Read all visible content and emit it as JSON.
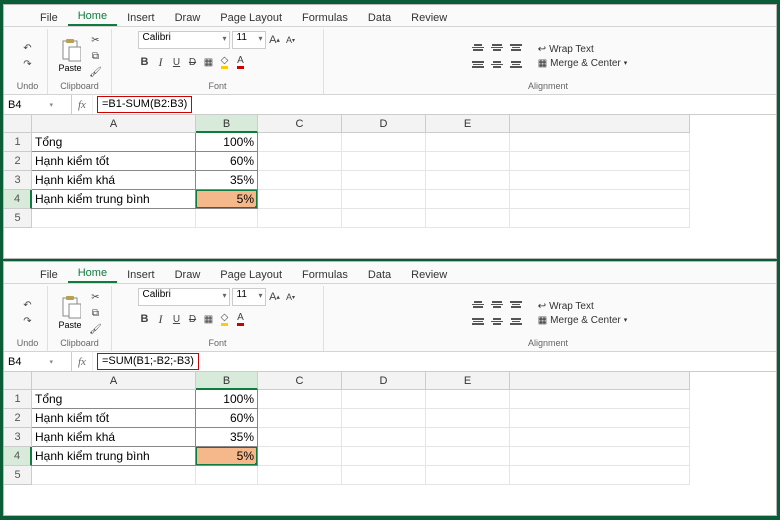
{
  "tabs": {
    "file": "File",
    "home": "Home",
    "insert": "Insert",
    "draw": "Draw",
    "pageLayout": "Page Layout",
    "formulas": "Formulas",
    "data": "Data",
    "review": "Review"
  },
  "ribbon": {
    "undo": "Undo",
    "clipboard": "Clipboard",
    "paste": "Paste",
    "font": "Font",
    "alignment": "Alignment",
    "fontName": "Calibri",
    "fontSize": "11",
    "wrapText": "Wrap Text",
    "mergeCenter": "Merge & Center",
    "B": "B",
    "I": "I",
    "U": "U",
    "D": "D"
  },
  "formulaBar": {
    "nameBox": "B4",
    "fx": "fx"
  },
  "top": {
    "formula": "=B1-SUM(B2:B3)"
  },
  "bottom": {
    "formula": "=SUM(B1;-B2;-B3)"
  },
  "chart_data": {
    "type": "table",
    "columns": [
      "A",
      "B"
    ],
    "rows": [
      {
        "A": "Tổng",
        "B": "100%"
      },
      {
        "A": "Hạnh kiểm tốt",
        "B": "60%"
      },
      {
        "A": "Hạnh kiểm khá",
        "B": "35%"
      },
      {
        "A": "Hạnh kiểm trung bình",
        "B": "5%"
      }
    ],
    "selected": "B4",
    "formulas": [
      "=B1-SUM(B2:B3)",
      "=SUM(B1;-B2;-B3)"
    ]
  },
  "cols": [
    "A",
    "B",
    "C",
    "D",
    "E"
  ],
  "rowNums": [
    "1",
    "2",
    "3",
    "4",
    "5"
  ]
}
